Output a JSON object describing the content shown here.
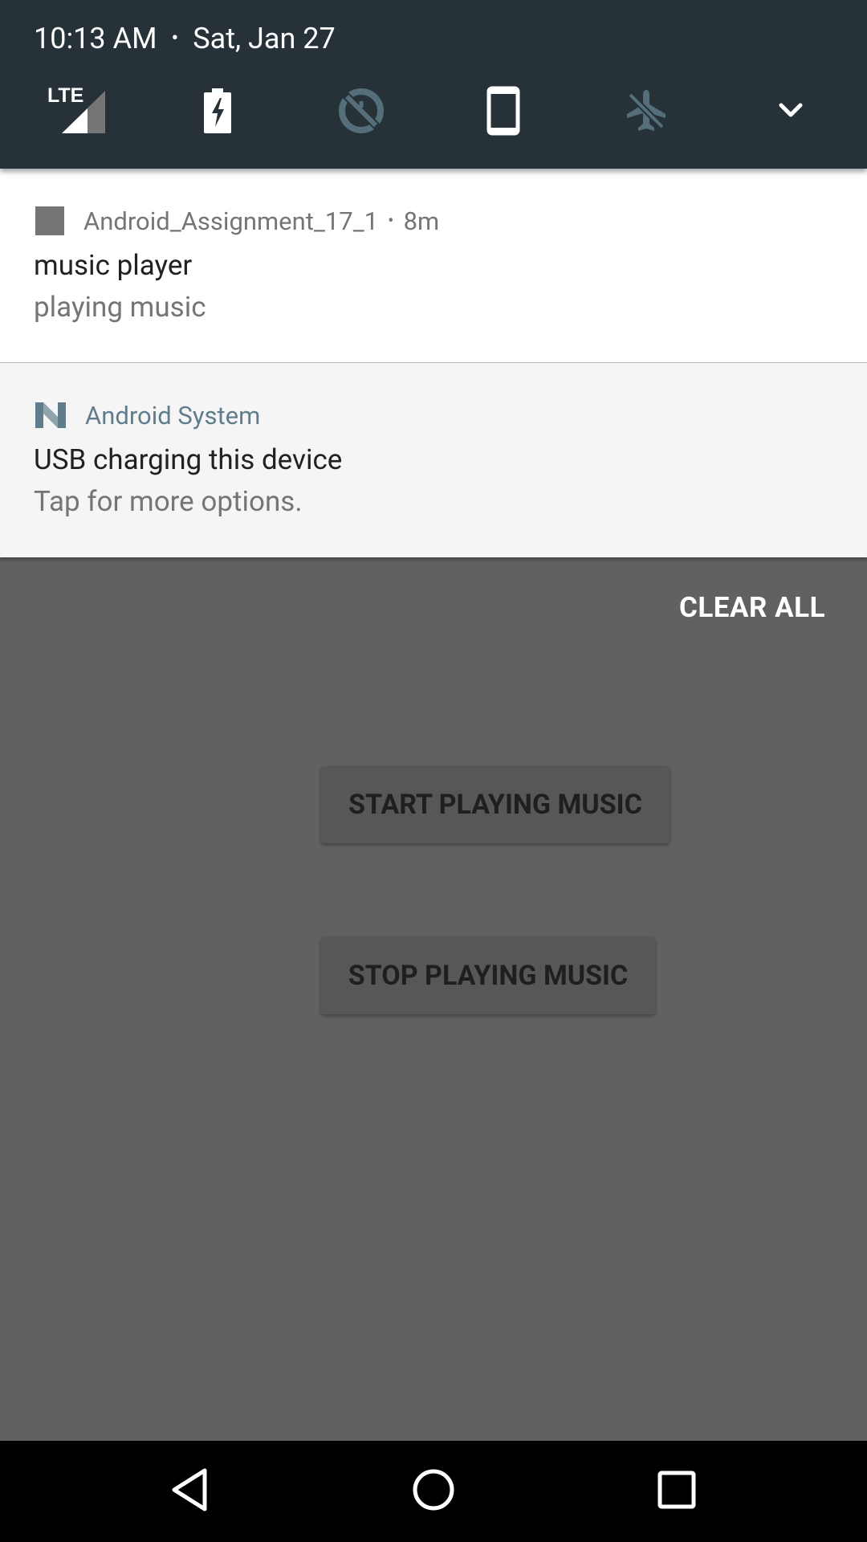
{
  "status": {
    "time": "10:13 AM",
    "separator": "•",
    "date": "Sat, Jan 27"
  },
  "quick_settings": {
    "tiles": [
      {
        "icon": "lte-signal-icon",
        "label": "LTE"
      },
      {
        "icon": "battery-charging-icon"
      },
      {
        "icon": "data-saver-off-icon"
      },
      {
        "icon": "phone-rotation-icon"
      },
      {
        "icon": "airplane-mode-icon"
      },
      {
        "icon": "chevron-down-icon"
      }
    ]
  },
  "notifications": [
    {
      "app": "Android_Assignment_17_1",
      "separator": "•",
      "time": "8m",
      "title": "music player",
      "text": "playing music",
      "icon": "app-square-icon"
    },
    {
      "app": "Android System",
      "title": "USB charging this device",
      "text": "Tap for more options.",
      "icon": "android-n-icon"
    }
  ],
  "shade": {
    "clear_all": "CLEAR ALL"
  },
  "app": {
    "start_button": "START PLAYING MUSIC",
    "stop_button": "STOP PLAYING MUSIC"
  },
  "navbar": {
    "buttons": [
      "back-icon",
      "home-icon",
      "recents-icon"
    ]
  },
  "colors": {
    "header_bg": "#263238",
    "scrim_bg": "#616161",
    "system_app_accent": "#607d8b"
  }
}
